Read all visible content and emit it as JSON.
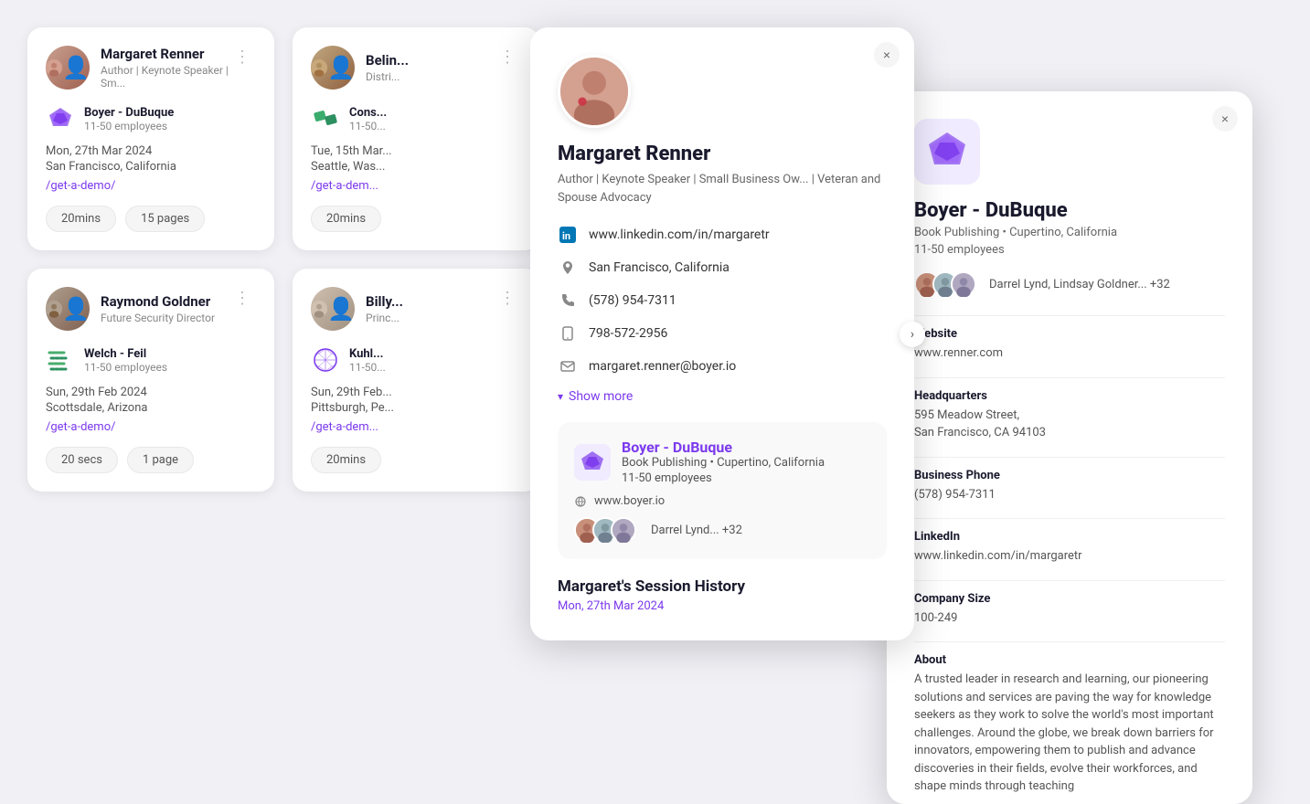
{
  "cards": [
    {
      "id": "margaret-renner",
      "name": "Margaret Renner",
      "title": "Author | Keynote Speaker | Sm...",
      "company": "Boyer - DuBuque",
      "companySize": "11-50 employees",
      "date": "Mon, 27th Mar 2024",
      "location": "San Francisco, California",
      "link": "/get-a-demo/",
      "duration": "20mins",
      "pages": "15 pages",
      "avatarType": "margaret"
    },
    {
      "id": "belin",
      "name": "Belin...",
      "title": "Distri...",
      "company": "Cons...",
      "companySize": "11-50...",
      "date": "Tue, 15th Mar...",
      "location": "Seattle, Was...",
      "link": "/get-a-dem...",
      "duration": "20mins",
      "pages": "",
      "avatarType": "belin"
    },
    {
      "id": "raymond-goldner",
      "name": "Raymond Goldner",
      "title": "Future Security Director",
      "company": "Welch - Feil",
      "companySize": "11-50 employees",
      "date": "Sun, 29th Feb 2024",
      "location": "Scottsdale, Arizona",
      "link": "/get-a-demo/",
      "duration": "20 secs",
      "pages": "1 page",
      "avatarType": "raymond"
    },
    {
      "id": "billy",
      "name": "Billy...",
      "title": "Princ...",
      "company": "Kuhl...",
      "companySize": "11-50...",
      "date": "Sun, 29th Feb...",
      "location": "Pittsburgh, Pe...",
      "link": "/get-a-dem...",
      "duration": "20mins",
      "pages": "",
      "avatarType": "billy"
    }
  ],
  "personPopup": {
    "name": "Margaret Renner",
    "title": "Author | Keynote Speaker | Small Business Ow... | Veteran and Spouse Advocacy",
    "linkedin": "www.linkedin.com/in/margaretr",
    "location": "San Francisco, California",
    "phone": "(578) 954-7311",
    "mobile": "798-572-2956",
    "email": "margaret.renner@boyer.io",
    "showMore": "Show more",
    "company": {
      "name": "Boyer - DuBuque",
      "desc": "Book Publishing • Cupertino, California",
      "employees": "11-50 employees",
      "website": "www.boyer.io",
      "contacts": "Darrel Lynd... +32"
    },
    "sessionHistory": {
      "title": "Margaret's Session History",
      "date": "Mon, 27th Mar 2024"
    },
    "closeLabel": "×"
  },
  "companyPopup": {
    "name": "Boyer - DuBuque",
    "desc": "Book Publishing • Cupertino, California",
    "size": "11-50 employees",
    "contacts": "Darrel Lynd, Lindsay Goldner... +32",
    "website": {
      "label": "Website",
      "value": "www.renner.com"
    },
    "headquarters": {
      "label": "Headquarters",
      "value": "595 Meadow Street,\nSan Francisco, CA 94103"
    },
    "businessPhone": {
      "label": "Business Phone",
      "value": "(578) 954-7311"
    },
    "linkedin": {
      "label": "LinkedIn",
      "value": "www.linkedin.com/in/margaretr"
    },
    "companySize": {
      "label": "Company Size",
      "value": "100-249"
    },
    "about": {
      "label": "About",
      "value": "A trusted leader in research and learning, our pioneering solutions and services are paving the way for knowledge seekers as they work to solve the world's most important challenges. Around the globe, we break down barriers for innovators, empowering them to publish and advance discoveries in their fields, evolve their workforces, and shape minds through teaching"
    },
    "closeLabel": "×"
  }
}
